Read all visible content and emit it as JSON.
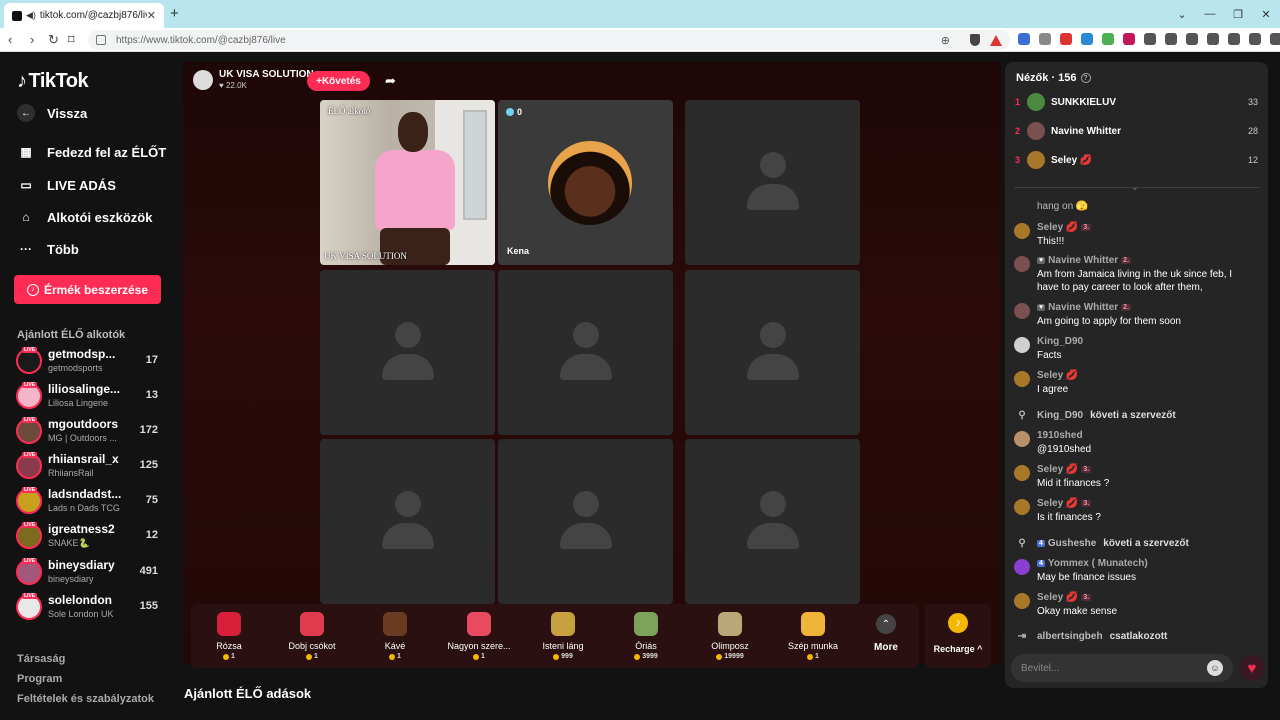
{
  "browser": {
    "tab_title": "tiktok.com/@cazbj876/live",
    "url": "https://www.tiktok.com/@cazbj876/live"
  },
  "sidebar": {
    "logo": "TikTok",
    "back": "Vissza",
    "nav": [
      "Fedezd fel az ÉLŐT",
      "LIVE ADÁS",
      "Alkotói eszközök",
      "Több"
    ],
    "coins_button": "Érmék beszerzése",
    "recommended_title": "Ajánlott ÉLŐ alkotók",
    "creators": [
      {
        "name": "getmodsp...",
        "sub": "getmodsports",
        "count": "17",
        "color": "#1a1a1a"
      },
      {
        "name": "liliosalinge...",
        "sub": "Liliosa Lingerie",
        "count": "13",
        "color": "#f3b6c8"
      },
      {
        "name": "mgoutdoors",
        "sub": "MG | Outdoors ...",
        "count": "172",
        "color": "#6b4a3a"
      },
      {
        "name": "rhiiansrail_x",
        "sub": "RhiiansRail",
        "count": "125",
        "color": "#8a3b4b"
      },
      {
        "name": "ladsndadst...",
        "sub": "Lads n Dads TCG",
        "count": "75",
        "color": "#c7a11e"
      },
      {
        "name": "igreatness2",
        "sub": "SNAKE🐍",
        "count": "12",
        "color": "#7a6b1e"
      },
      {
        "name": "bineysdiary",
        "sub": "bineysdiary",
        "count": "491",
        "color": "#a4577a"
      },
      {
        "name": "solelondon",
        "sub": "Sole London UK",
        "count": "155",
        "color": "#e8e8e8"
      }
    ],
    "footer": [
      "Társaság",
      "Program",
      "Feltételek és szabályzatok"
    ]
  },
  "host": {
    "name": "UK VISA SOLUTION",
    "likes": "22.0K",
    "follow": "+Követés"
  },
  "grid": {
    "video_label": "ÉLŐ alkotó",
    "video_name": "UK VISA SOLUTION",
    "guest_count": "0",
    "guest_name": "Kena"
  },
  "gifts": [
    {
      "name": "Rózsa",
      "cost": "1",
      "color": "#d8203a"
    },
    {
      "name": "Dobj csókot",
      "cost": "1",
      "color": "#e03c50"
    },
    {
      "name": "Kávé",
      "cost": "1",
      "color": "#6b3a20"
    },
    {
      "name": "Nagyon szere...",
      "cost": "1",
      "color": "#e84a5f"
    },
    {
      "name": "Isteni láng",
      "cost": "999",
      "color": "#c8a040"
    },
    {
      "name": "Óriás",
      "cost": "3999",
      "color": "#7ca35a"
    },
    {
      "name": "Olimposz",
      "cost": "19999",
      "color": "#b9a77a"
    },
    {
      "name": "Szép munka",
      "cost": "1",
      "color": "#f0b43a"
    }
  ],
  "more_label": "More",
  "recharge_label": "Recharge ^",
  "recommended_streams": "Ajánlott ÉLŐ adások",
  "chat": {
    "viewers_title": "Nézők · 156",
    "top_viewers": [
      {
        "rank": "1",
        "name": "SUNKKIELUV",
        "score": "33",
        "color": "#4c8a3f"
      },
      {
        "rank": "2",
        "name": "Navine Whitter",
        "score": "28",
        "color": "#7a5050"
      },
      {
        "rank": "3",
        "name": "Seley 💋",
        "score": "12",
        "color": "#a8782a"
      }
    ],
    "partial_message": "hang on 🫣",
    "messages": [
      {
        "user": "Seley 💋",
        "badge": "3.",
        "text": "This!!!",
        "color": "#a8782a",
        "lvl": ""
      },
      {
        "user": "Navine Whitter",
        "badge": "2.",
        "text": "Am from Jamaica living in the uk since feb, I have to pay career to look after them,",
        "color": "#7a5050",
        "lvl": "gray"
      },
      {
        "user": "Navine Whitter",
        "badge": "2.",
        "text": "Am going to apply for them soon",
        "color": "#7a5050",
        "lvl": "gray"
      },
      {
        "user": "King_D90",
        "badge": "",
        "text": "Facts",
        "color": "#cfcfcf",
        "lvl": ""
      },
      {
        "user": "Seley 💋",
        "badge": "",
        "text": "I agree",
        "color": "#a8782a",
        "lvl": ""
      }
    ],
    "follow_event_1": {
      "user": "King_D90",
      "action": "követi a szervezőt"
    },
    "messages2": [
      {
        "user": "1910shed",
        "badge": "",
        "text": "@1910shed",
        "color": "#b8906a"
      },
      {
        "user": "Seley 💋",
        "badge": "3.",
        "text": "Mid it finances ?",
        "color": "#a8782a"
      },
      {
        "user": "Seley 💋",
        "badge": "3.",
        "text": "Is it finances ?",
        "color": "#a8782a"
      }
    ],
    "follow_event_2": {
      "level": "4",
      "user": "Gusheshe",
      "action": "követi a szervezőt"
    },
    "messages3": [
      {
        "level": "4",
        "user": "Yommex ( Munatech)",
        "text": "May be finance issues",
        "color": "#8a3fd1"
      },
      {
        "user": "Seley 💋",
        "badge": "3.",
        "text": "Okay make sense",
        "color": "#a8782a"
      }
    ],
    "join_event": {
      "user": "albertsingbeh",
      "action": "csatlakozott"
    },
    "input_placeholder": "Bevitel..."
  }
}
